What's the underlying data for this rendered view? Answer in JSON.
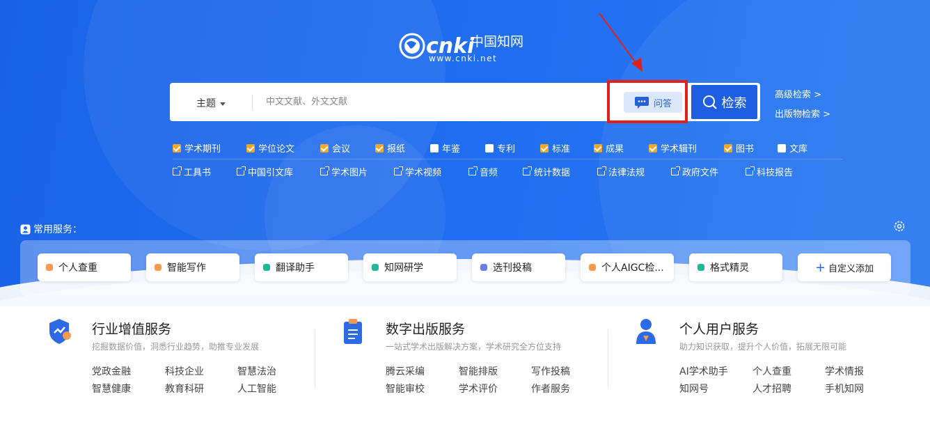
{
  "logo": {
    "brand": "cnki",
    "chinese": "中国知网",
    "url_text": "www.cnki.net"
  },
  "search": {
    "field_selector": "主题",
    "placeholder": "中文文献、外文文献",
    "qa_label": "问答",
    "search_label": "检索",
    "advanced_label": "高级检索 >",
    "publication_label": "出版物检索 >"
  },
  "databases": [
    {
      "label": "学术期刊",
      "checked": true
    },
    {
      "label": "学位论文",
      "checked": true
    },
    {
      "label": "会议",
      "checked": true
    },
    {
      "label": "报纸",
      "checked": true
    },
    {
      "label": "年鉴",
      "checked": false
    },
    {
      "label": "专利",
      "checked": false
    },
    {
      "label": "标准",
      "checked": true
    },
    {
      "label": "成果",
      "checked": true
    },
    {
      "label": "学术辑刊",
      "checked": true
    },
    {
      "label": "图书",
      "checked": true
    },
    {
      "label": "文库",
      "checked": false
    }
  ],
  "resources": [
    "工具书",
    "中国引文库",
    "学术图片",
    "学术视频",
    "音频",
    "统计数据",
    "法律法规",
    "政府文件",
    "科技报告"
  ],
  "common_services": {
    "title": "常用服务：",
    "items": [
      {
        "label": "个人查重",
        "color": "#f39a52"
      },
      {
        "label": "智能写作",
        "color": "#f39a52"
      },
      {
        "label": "翻译助手",
        "color": "#27b59a"
      },
      {
        "label": "知网研学",
        "color": "#27b59a"
      },
      {
        "label": "选刊投稿",
        "color": "#6a7fdc"
      },
      {
        "label": "个人AIGC检...",
        "color": "#f39a52"
      },
      {
        "label": "格式精灵",
        "color": "#27b59a"
      }
    ],
    "add_label": "自定义添加"
  },
  "sections": [
    {
      "title": "行业增值服务",
      "subtitle": "挖掘数据价值，洞悉行业趋势，助推专业发展",
      "links": [
        "党政金融",
        "科技企业",
        "智慧法治",
        "智慧健康",
        "教育科研",
        "人工智能"
      ]
    },
    {
      "title": "数字出版服务",
      "subtitle": "一站式学术出版解决方案，学术研究全方位支持",
      "links": [
        "腾云采编",
        "智能排版",
        "写作投稿",
        "智能审校",
        "学术评价",
        "作者服务"
      ]
    },
    {
      "title": "个人用户服务",
      "subtitle": "助力知识获取，提升个人价值，拓展无限可能",
      "links": [
        "AI学术助手",
        "个人查重",
        "学术情报",
        "知网号",
        "人才招聘",
        "手机知网"
      ]
    }
  ],
  "colors": {
    "hero": "#1f6cf0",
    "accent": "#1d5fe0",
    "highlight": "#e0201a",
    "check": "#f0a82a"
  }
}
